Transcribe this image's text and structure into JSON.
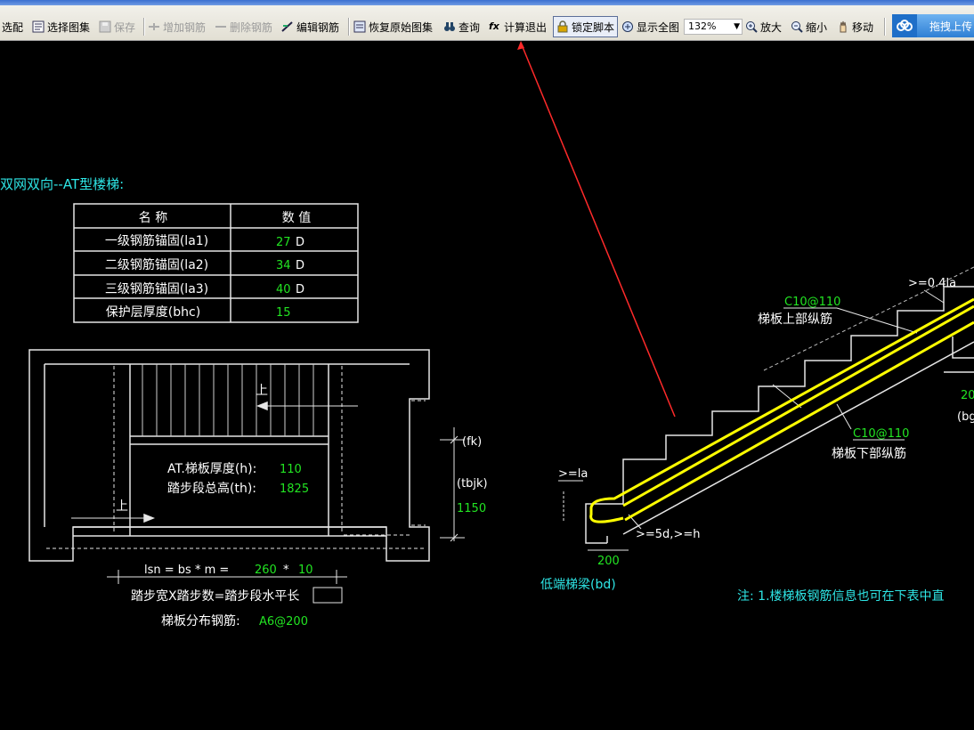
{
  "toolbar": {
    "items": [
      {
        "label": "选配",
        "icon": "select-icon",
        "enabled": true
      },
      {
        "label": "选择图集",
        "icon": "atlas-icon",
        "enabled": true
      },
      {
        "label": "保存",
        "icon": "save-icon",
        "enabled": false
      },
      {
        "label": "增加钢筋",
        "icon": "add-rebar-icon",
        "enabled": false
      },
      {
        "label": "删除钢筋",
        "icon": "delete-rebar-icon",
        "enabled": false
      },
      {
        "label": "编辑钢筋",
        "icon": "edit-rebar-icon",
        "enabled": true
      },
      {
        "label": "恢复原始图集",
        "icon": "restore-icon",
        "enabled": true
      },
      {
        "label": "查询",
        "icon": "binoculars-icon",
        "enabled": true
      },
      {
        "label": "计算退出",
        "icon": "fx-icon",
        "enabled": true
      },
      {
        "label": "锁定脚本",
        "icon": "lock-icon",
        "enabled": true,
        "pressed": true
      },
      {
        "label": "显示全图",
        "icon": "zoom-all-icon",
        "enabled": true
      },
      {
        "label": "放大",
        "icon": "zoom-in-icon",
        "enabled": true
      },
      {
        "label": "缩小",
        "icon": "zoom-out-icon",
        "enabled": true
      },
      {
        "label": "移动",
        "icon": "hand-icon",
        "enabled": true
      }
    ],
    "zoom_value": "132%",
    "upload_label": "拖拽上传"
  },
  "drawing": {
    "heading": "双网双向--AT型楼梯:",
    "table": {
      "headers": [
        "名 称",
        "数 值"
      ],
      "rows": [
        {
          "name": "一级钢筋锚固(la1)",
          "value": "27",
          "unit": "D"
        },
        {
          "name": "二级钢筋锚固(la2)",
          "value": "34",
          "unit": "D"
        },
        {
          "name": "三级钢筋锚固(la3)",
          "value": "40",
          "unit": "D"
        },
        {
          "name": "保护层厚度(bhc)",
          "value": "15",
          "unit": ""
        }
      ]
    },
    "plan": {
      "up1": "上",
      "up2": "上",
      "thickness_label": "AT.梯板厚度(h):",
      "thickness_value": "110",
      "height_label": "踏步段总高(th):",
      "height_value": "1825",
      "fk": "(fk)",
      "tbjk": "(tbjk)",
      "tbjk_value": "1150",
      "lsn_label": "lsn = bs * m =",
      "bs_value": "260",
      "times": "*",
      "m_value": "10",
      "formula": "踏步宽X踏步数=踏步段水平长",
      "dist_label": "梯板分布钢筋:",
      "dist_value": "A6@200"
    },
    "section": {
      "top_rebar_value": "C10@110",
      "top_rebar_label": "梯板上部纵筋",
      "bottom_rebar_value": "C10@110",
      "bottom_rebar_label": "梯板下部纵筋",
      "anchor_top": ">=0.4la",
      "anchor_la": ">=la",
      "anchor_5d": ">=5d,>=h",
      "beam_width": "200",
      "beam_width_right": "20",
      "beam_label_right": "(bg",
      "low_beam_label": "低端梯梁(bd)",
      "note": "注: 1.楼梯板钢筋信息也可在下表中直"
    }
  },
  "colors": {
    "background": "#000000",
    "cyan_text": "#2ee6e6",
    "green_value": "#22e422",
    "white_line": "#e6e6e6",
    "rebar_yellow": "#ffff00",
    "arrow_red": "#ff2a2a"
  }
}
